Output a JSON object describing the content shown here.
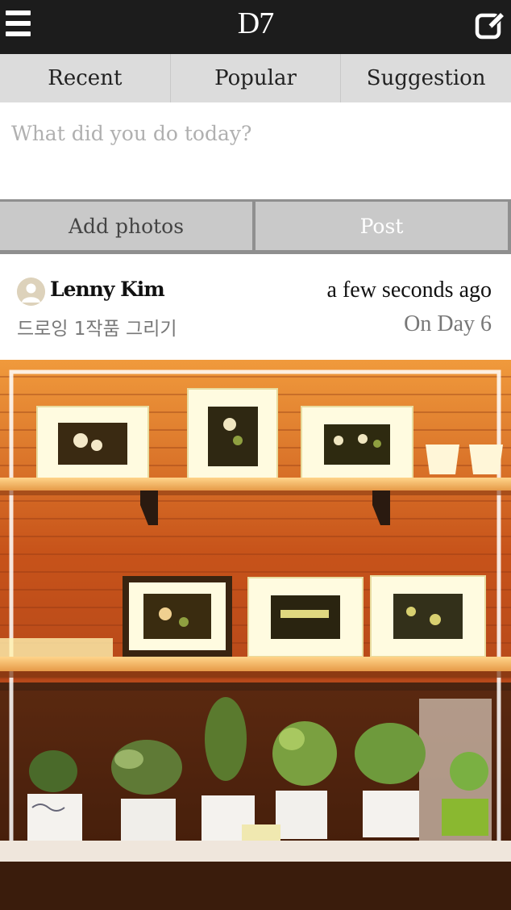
{
  "header": {
    "logo": "D7",
    "menu_icon": "hamburger-menu-icon",
    "compose_icon": "edit-compose-icon"
  },
  "tabs": [
    {
      "label": "Recent"
    },
    {
      "label": "Popular"
    },
    {
      "label": "Suggestion"
    }
  ],
  "composer": {
    "placeholder": "What did you do today?",
    "value": "",
    "add_photos_label": "Add photos",
    "post_label": "Post"
  },
  "post": {
    "author": "Lenny Kim",
    "time_ago": "a few seconds ago",
    "caption": "드로잉 1작품 그리기",
    "day": "On Day 6",
    "avatar_icon": "default-avatar-icon"
  },
  "colors": {
    "topbar": "#1c1c1c",
    "tabs_bg": "#dcdcdc",
    "button_bg": "#c9c9c9",
    "muted_text": "#777777",
    "placeholder": "#b0b0b0"
  }
}
